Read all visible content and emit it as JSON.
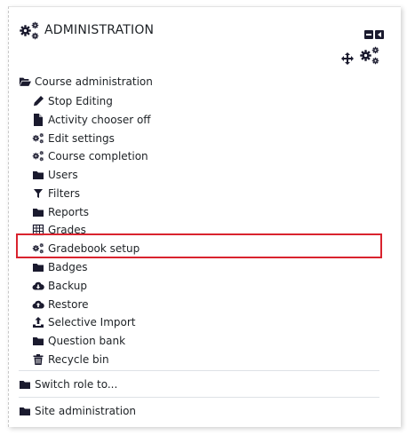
{
  "block": {
    "title": "ADMINISTRATION",
    "header_icon": "cogs-icon",
    "controls": {
      "collapse_icon": "collapse-minus-icon",
      "dock_icon": "dock-left-icon",
      "move_icon": "move-arrows-icon",
      "actions_icon": "cogs-icon"
    }
  },
  "nav": {
    "course_admin": {
      "label": "Course administration",
      "icon": "folder-open-icon",
      "expanded": true,
      "children": [
        {
          "label": "Stop Editing",
          "icon": "pencil-icon"
        },
        {
          "label": "Activity chooser off",
          "icon": "file-icon"
        },
        {
          "label": "Edit settings",
          "icon": "cogs-icon"
        },
        {
          "label": "Course completion",
          "icon": "cogs-icon"
        },
        {
          "label": "Users",
          "icon": "folder-icon"
        },
        {
          "label": "Filters",
          "icon": "filter-icon"
        },
        {
          "label": "Reports",
          "icon": "folder-icon"
        },
        {
          "label": "Grades",
          "icon": "table-icon"
        },
        {
          "label": "Gradebook setup",
          "icon": "cogs-icon",
          "highlighted": true
        },
        {
          "label": "Badges",
          "icon": "folder-icon"
        },
        {
          "label": "Backup",
          "icon": "cloud-download-icon"
        },
        {
          "label": "Restore",
          "icon": "cloud-upload-icon"
        },
        {
          "label": "Selective Import",
          "icon": "upload-icon"
        },
        {
          "label": "Question bank",
          "icon": "folder-icon"
        },
        {
          "label": "Recycle bin",
          "icon": "trash-icon"
        }
      ]
    },
    "switch_role": {
      "label": "Switch role to...",
      "icon": "folder-icon"
    },
    "site_admin": {
      "label": "Site administration",
      "icon": "folder-icon"
    }
  },
  "colors": {
    "icon": "#1a1a2e",
    "text": "#1d2125",
    "highlight_border": "#d9232e",
    "separator": "#dee2e6"
  }
}
